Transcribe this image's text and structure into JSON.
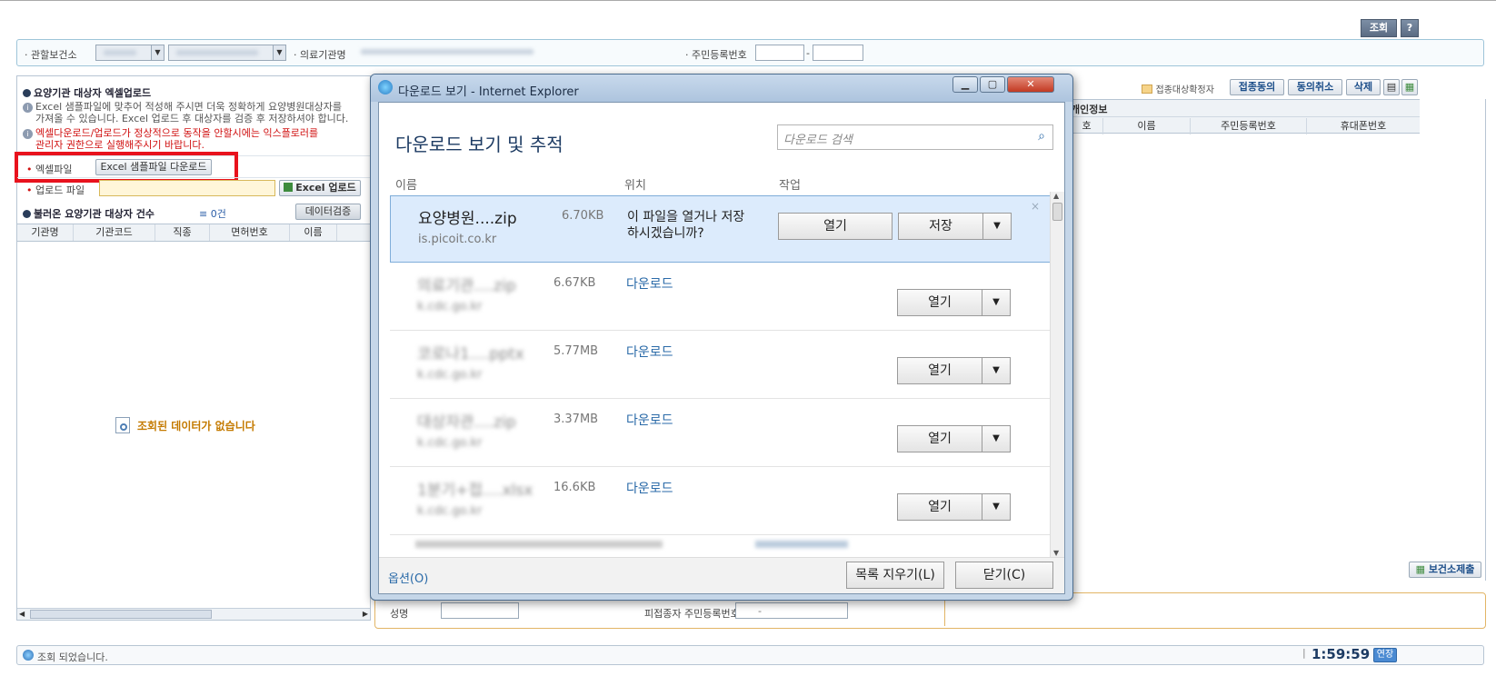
{
  "topbar": {
    "search_label": "조회",
    "help_label": "?"
  },
  "searchbar": {
    "health_center_label": "· 관할보건소",
    "institution_label": "· 의료기관명",
    "rrn_label": "· 주민등록번호",
    "rrn_dash": "-"
  },
  "left": {
    "upload_title": "요양기관 대상자 엑셀업로드",
    "info1_line1": "Excel 샘플파일에 맞추어 적성해 주시면 더욱 정확하게 요양병원대상자를",
    "info1_line2": "가져올 수 있습니다. Excel 업로드 후 대상자를 검증 후 저장하셔야 합니다.",
    "info2_line1": "엑셀다운로드/업로드가 정상적으로 동작을 안할시에는 익스플로러를",
    "info2_line2": "관리자 권한으로 실행해주시기 바랍니다.",
    "excel_file_label": "엑셀파일",
    "sample_download_label": "Excel 샘플파일 다운로드",
    "upload_file_label": "업로드 파일",
    "excel_upload_label": "Excel 업로드",
    "loaded_title": "불러온 요양기관 대상자 건수",
    "count_text": "0건",
    "verify_label": "데이터검증",
    "columns": [
      "기관명",
      "기관코드",
      "직종",
      "면허번호",
      "이름"
    ],
    "empty_message": "조회된 데이터가 없습니다"
  },
  "right": {
    "legend_label": "접종대상확정자",
    "consent_label": "접종동의",
    "cancel_consent_label": "동의취소",
    "delete_label": "삭제",
    "group_header": "개인정보",
    "columns": [
      "호",
      "이름",
      "주민등록번호",
      "휴대폰번호"
    ],
    "submit_label": "보건소제출"
  },
  "bottom": {
    "name_label": "성명",
    "vaccinee_rrn_label": "피접종자 주민등록번호",
    "rrn_dash": "-"
  },
  "dialog": {
    "title": "다운로드 보기 - Internet Explorer",
    "heading": "다운로드 보기 및 추적",
    "search_placeholder": "다운로드 검색",
    "col_name": "이름",
    "col_location": "위치",
    "col_action": "작업",
    "rows": [
      {
        "name": "요양병원....zip",
        "size": "6.70KB",
        "site": "is.picoit.co.kr",
        "status_line1": "이 파일을 열거나 저장",
        "status_line2": "하시겠습니까?",
        "open": "열기",
        "save": "저장"
      },
      {
        "name": "의료기관....zip",
        "size": "6.67KB",
        "site": "k.cdc.go.kr",
        "status": "다운로드",
        "open": "열기"
      },
      {
        "name": "코로나1....pptx",
        "size": "5.77MB",
        "site": "k.cdc.go.kr",
        "status": "다운로드",
        "open": "열기"
      },
      {
        "name": "대상자관....zip",
        "size": "3.37MB",
        "site": "k.cdc.go.kr",
        "status": "다운로드",
        "open": "열기"
      },
      {
        "name": "1분기+접....xlsx",
        "size": "16.6KB",
        "site": "k.cdc.go.kr",
        "status": "다운로드",
        "open": "열기"
      }
    ],
    "options_label": "옵션(O)",
    "clear_list_label": "목록 지우기(L)",
    "close_label": "닫기(C)"
  },
  "statusbar": {
    "message": "조회 되었습니다.",
    "time": "1:59:59",
    "extend_label": "연장"
  }
}
